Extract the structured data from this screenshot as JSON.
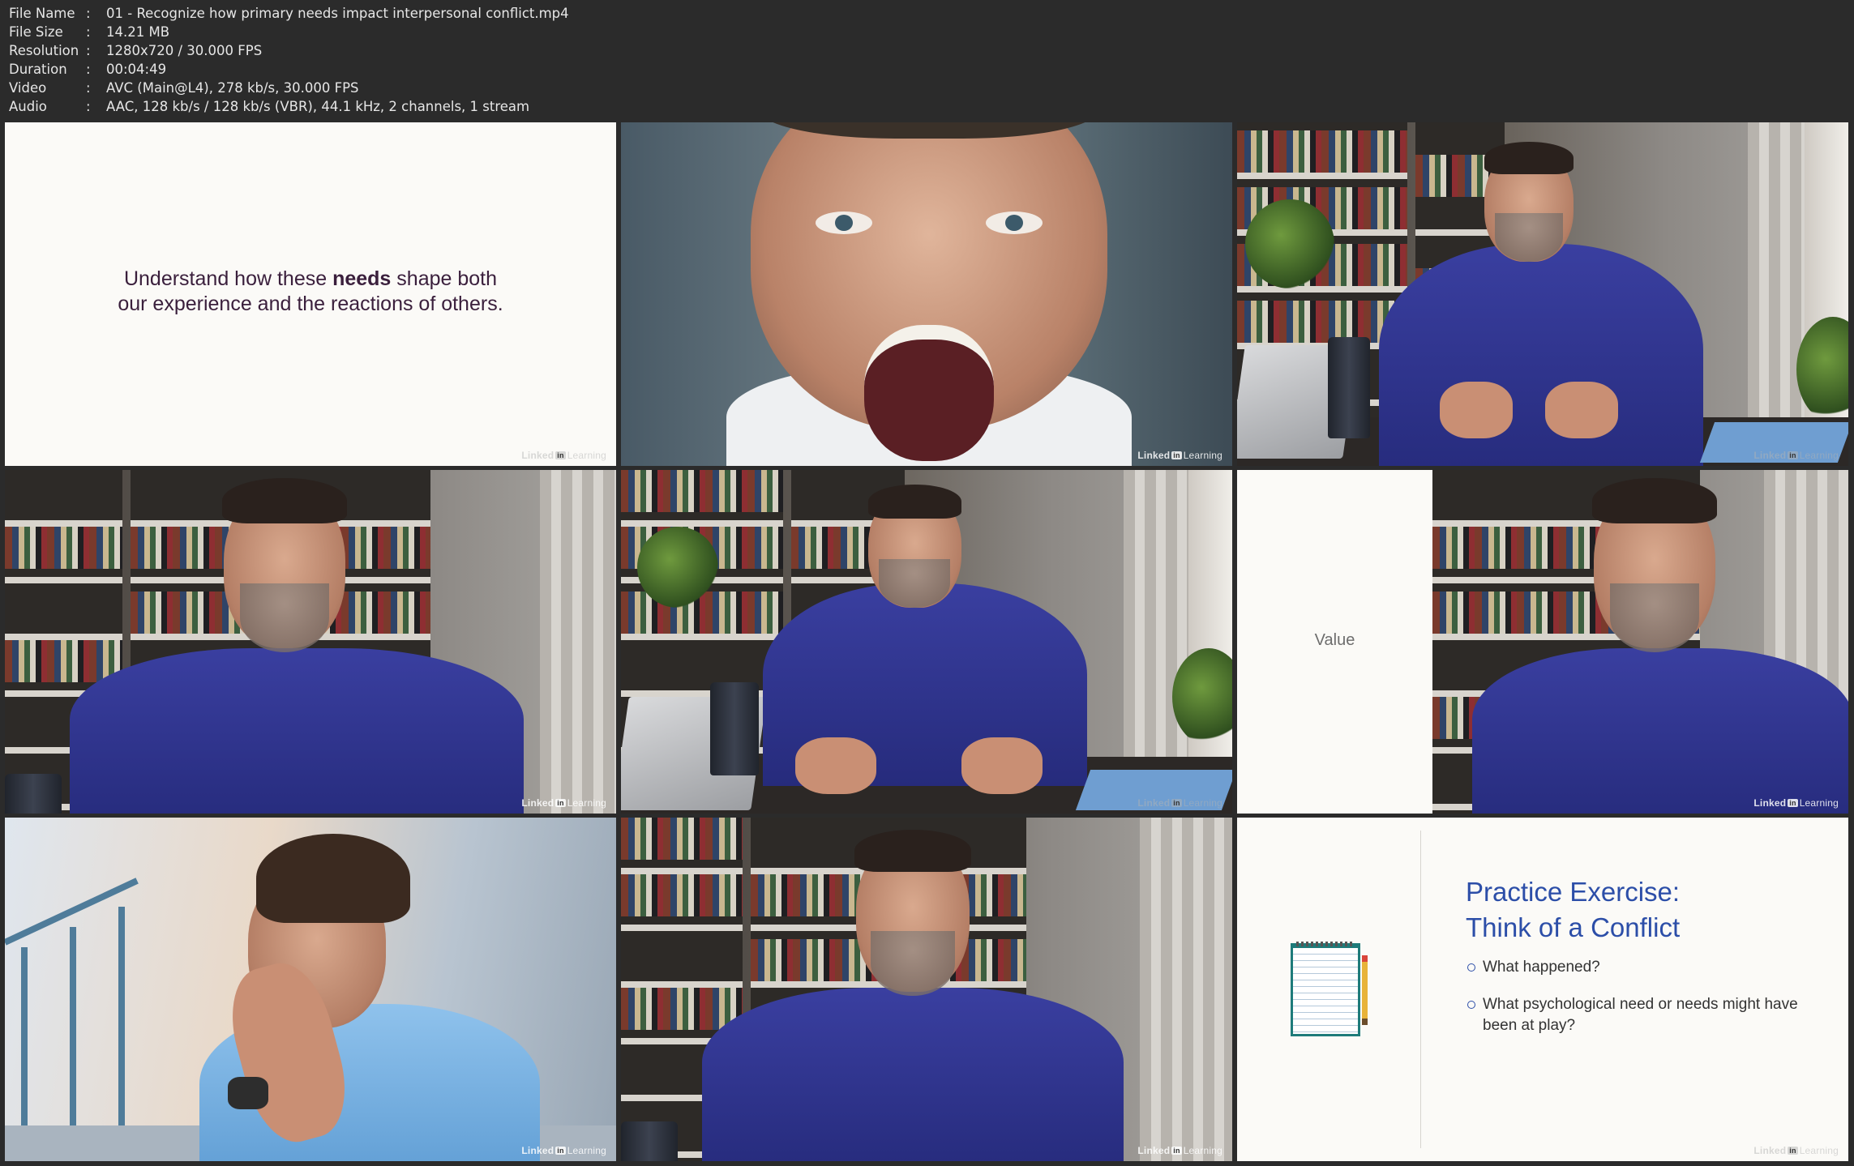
{
  "file_info": [
    {
      "key": "File Name",
      "value": "01 - Recognize how primary needs impact interpersonal conflict.mp4"
    },
    {
      "key": "File Size",
      "value": "14.21 MB"
    },
    {
      "key": "Resolution",
      "value": "1280x720 / 30.000 FPS"
    },
    {
      "key": "Duration",
      "value": "00:04:49"
    },
    {
      "key": "Video",
      "value": "AVC (Main@L4), 278 kb/s, 30.000 FPS"
    },
    {
      "key": "Audio",
      "value": "AAC, 128 kb/s / 128 kb/s (VBR), 44.1 kHz, 2 channels, 1 stream"
    }
  ],
  "separator": ":",
  "watermark": {
    "brand": "Linked",
    "in": "in",
    "product": "Learning"
  },
  "slide1": {
    "before": "Understand how these ",
    "bold": "needs",
    "after": " shape both",
    "line2": "our experience and the reactions of others."
  },
  "value_slide": {
    "text": "Value"
  },
  "practice": {
    "title_line1": "Practice Exercise:",
    "title_line2": "Think of a Conflict",
    "bullets": [
      "What happened?",
      "What psychological need or needs might have been at play?"
    ]
  },
  "icons": {
    "notepad": "notepad-icon",
    "pencil": "pencil-icon"
  }
}
